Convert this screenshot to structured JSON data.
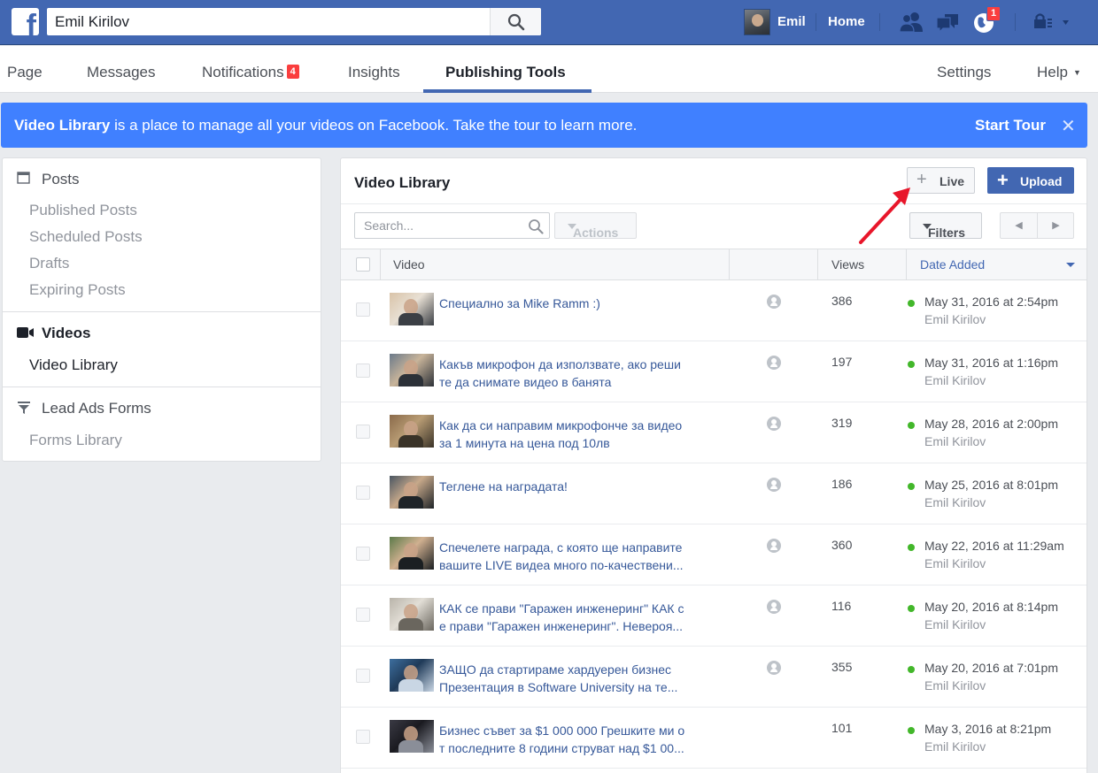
{
  "topbar": {
    "search_value": "Emil Kirilov",
    "profile_name": "Emil",
    "home_label": "Home",
    "notifications_count": "1"
  },
  "pagenav": {
    "tabs": [
      {
        "label": "Page"
      },
      {
        "label": "Messages"
      },
      {
        "label": "Notifications",
        "count": "4"
      },
      {
        "label": "Insights"
      },
      {
        "label": "Publishing Tools",
        "active": true
      },
      {
        "label": "Settings"
      },
      {
        "label": "Help"
      }
    ]
  },
  "banner": {
    "bold": "Video Library",
    "text": " is a place to manage all your videos on Facebook. Take the tour to learn more.",
    "tour_label": "Start Tour",
    "close_glyph": "✕"
  },
  "sidebar": {
    "sections": [
      {
        "title": "Posts",
        "icon": "calendar-icon",
        "items": [
          "Published Posts",
          "Scheduled Posts",
          "Drafts",
          "Expiring Posts"
        ]
      },
      {
        "title": "Videos",
        "icon": "video-camera-icon",
        "items": [
          "Video Library"
        ]
      },
      {
        "title": "Lead Ads Forms",
        "icon": "filter-funnel-icon",
        "items": [
          "Forms Library"
        ]
      }
    ]
  },
  "main": {
    "title": "Video Library",
    "live_label": "Live",
    "upload_label": "Upload",
    "search_placeholder": "Search...",
    "actions_label": "Actions",
    "filters_label": "Filters",
    "columns": {
      "video": "Video",
      "views": "Views",
      "date_added": "Date Added"
    },
    "rows": [
      {
        "title1": "Специално за Mike Ramm :)",
        "title2": "",
        "views": "386",
        "date": "May 31, 2016 at 2:54pm",
        "author": "Emil Kirilov",
        "visibility": true
      },
      {
        "title1": "Какъв микрофон да използвате, ако реши",
        "title2": "те да снимате видео в банята",
        "views": "197",
        "date": "May 31, 2016 at 1:16pm",
        "author": "Emil Kirilov",
        "visibility": true
      },
      {
        "title1": "Как да си направим микрофонче за видео",
        "title2": "за 1 минута на цена под 10лв",
        "views": "319",
        "date": "May 28, 2016 at 2:00pm",
        "author": "Emil Kirilov",
        "visibility": true
      },
      {
        "title1": "Теглене на наградата!",
        "title2": "",
        "views": "186",
        "date": "May 25, 2016 at 8:01pm",
        "author": "Emil Kirilov",
        "visibility": true
      },
      {
        "title1": "Спечелете награда, с която ще направите",
        "title2": "вашите LIVE видеа много по-качествени...",
        "views": "360",
        "date": "May 22, 2016 at 11:29am",
        "author": "Emil Kirilov",
        "visibility": true
      },
      {
        "title1": "КАК се прави \"Гаражен инженеринг\" КАК с",
        "title2": "е прави \"Гаражен инженеринг\". Невероя...",
        "views": "116",
        "date": "May 20, 2016 at 8:14pm",
        "author": "Emil Kirilov",
        "visibility": true
      },
      {
        "title1": "ЗАЩО да стартираме хардуерен бизнес",
        "title2": "Презентация в Software University на те...",
        "views": "355",
        "date": "May 20, 2016 at 7:01pm",
        "author": "Emil Kirilov",
        "visibility": true
      },
      {
        "title1": "Бизнес съвет за $1 000 000 Грешките ми о",
        "title2": "т последните 8 години струват над $1 00...",
        "views": "101",
        "date": "May 3, 2016 at 8:21pm",
        "author": "Emil Kirilov",
        "visibility": false
      }
    ]
  },
  "colors": {
    "brand_blue": "#4267b2",
    "banner_blue": "#4080ff",
    "link_blue": "#365899",
    "status_green": "#42b72a",
    "badge_red": "#fa3e3e",
    "annotation_arrow": "#e8162a"
  }
}
